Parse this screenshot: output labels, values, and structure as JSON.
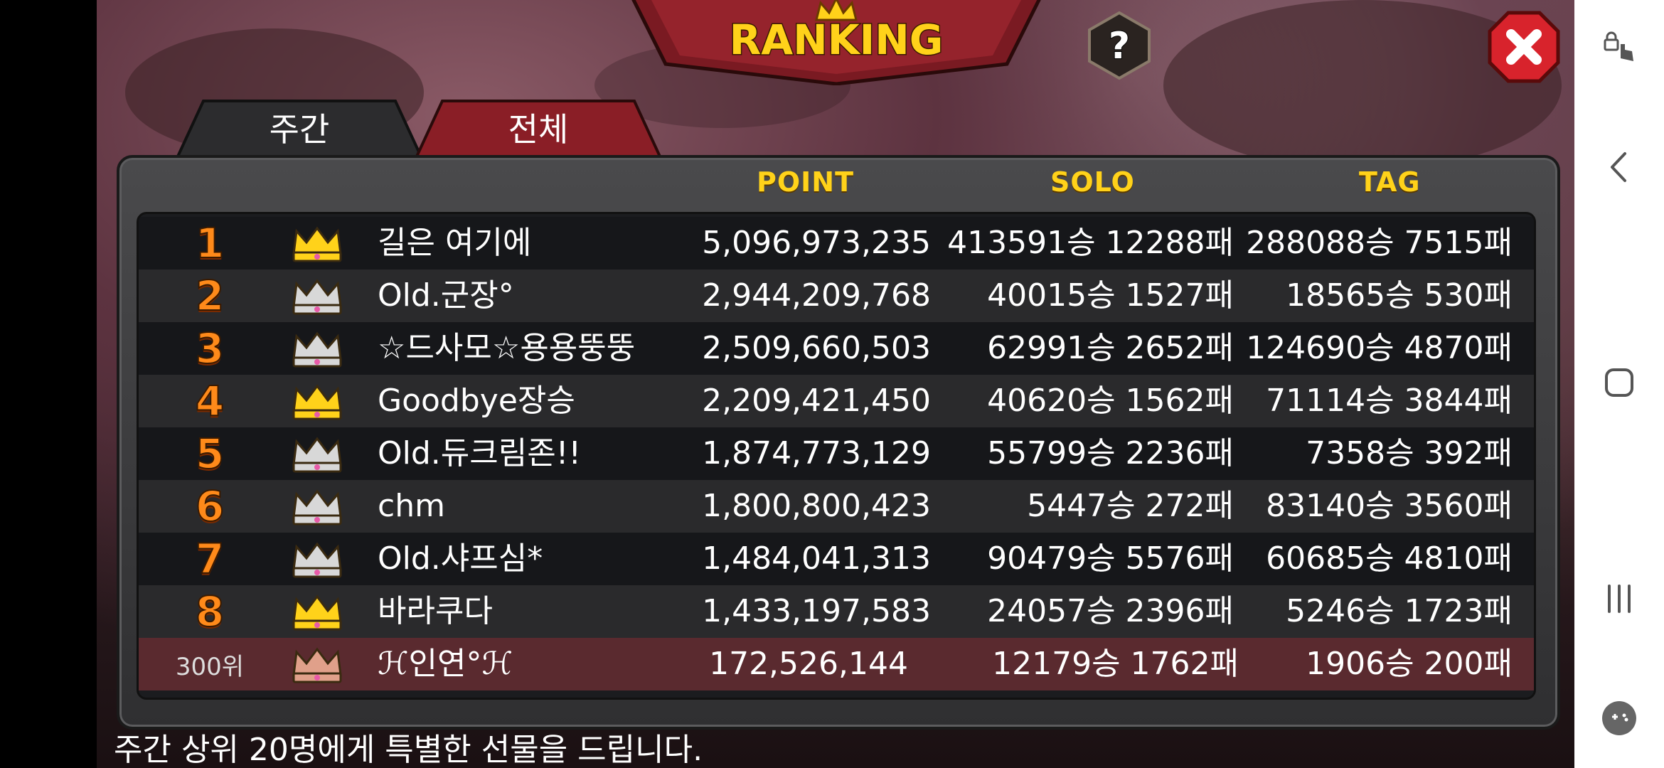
{
  "header": {
    "title": "RANKING"
  },
  "tabs": [
    {
      "label": "주간",
      "active": true
    },
    {
      "label": "전체",
      "active": false
    }
  ],
  "columns": {
    "point": "POINT",
    "solo": "SOLO",
    "tag": "TAG"
  },
  "rows": [
    {
      "rank": "1",
      "crown": "gold",
      "name": "길은 여기에",
      "point": "5,096,973,235",
      "solo": "413591승 12288패",
      "tag": "288088승 7515패"
    },
    {
      "rank": "2",
      "crown": "silver",
      "name": "Old.군장°",
      "point": "2,944,209,768",
      "solo": "40015승 1527패",
      "tag": "18565승 530패"
    },
    {
      "rank": "3",
      "crown": "silver",
      "name": "☆드사모☆용용뚱뚱",
      "point": "2,509,660,503",
      "solo": "62991승 2652패",
      "tag": "124690승 4870패"
    },
    {
      "rank": "4",
      "crown": "gold",
      "name": "Goodbye장승",
      "point": "2,209,421,450",
      "solo": "40620승 1562패",
      "tag": "71114승 3844패"
    },
    {
      "rank": "5",
      "crown": "silver",
      "name": "Old.듀크림존!!",
      "point": "1,874,773,129",
      "solo": "55799승 2236패",
      "tag": "7358승 392패"
    },
    {
      "rank": "6",
      "crown": "silver",
      "name": "chm",
      "point": "1,800,800,423",
      "solo": "5447승 272패",
      "tag": "83140승 3560패"
    },
    {
      "rank": "7",
      "crown": "silver",
      "name": "Old.샤프심*",
      "point": "1,484,041,313",
      "solo": "90479승 5576패",
      "tag": "60685승 4810패"
    },
    {
      "rank": "8",
      "crown": "gold",
      "name": "바라쿠다",
      "point": "1,433,197,583",
      "solo": "24057승 2396패",
      "tag": "5246승 1723패"
    }
  ],
  "my_row": {
    "rank": "300위",
    "crown": "bronze",
    "name": "ℋ인연°ℋ",
    "point": "172,526,144",
    "solo": "12179승 1762패",
    "tag": "1906승 200패"
  },
  "footer": "주간 상위 20명에게 특별한 선물을 드립니다.",
  "colors": {
    "gold": "#ffd21a",
    "silver": "#d8d8d8",
    "bronze": "#e0a08a",
    "rank": "#ff8a1a",
    "tab_active": "#2c2c2e",
    "tab_inactive": "#8a1e26"
  },
  "icons": {
    "help": "question-icon",
    "close": "close-icon",
    "crown": "crown-icon"
  },
  "system_nav": [
    "touch-lock-icon",
    "back-icon",
    "home-icon",
    "recents-icon",
    "game-tools-icon"
  ]
}
